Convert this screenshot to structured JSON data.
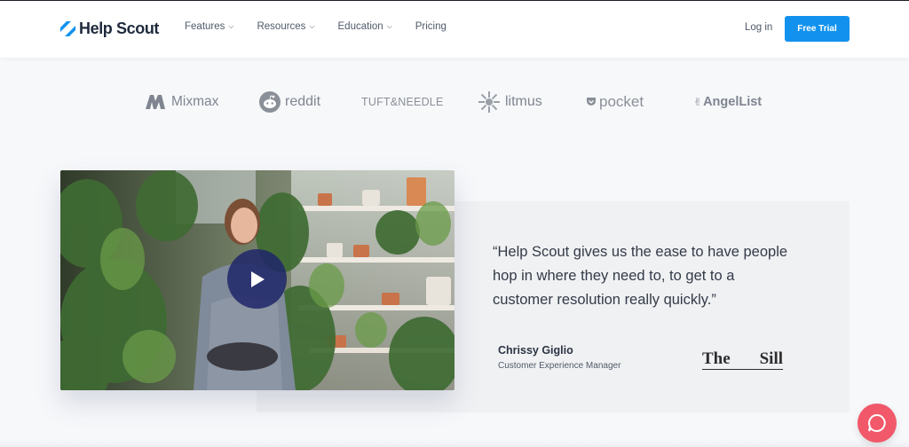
{
  "header": {
    "brand": "Help Scout",
    "nav": [
      {
        "label": "Features",
        "dropdown": true
      },
      {
        "label": "Resources",
        "dropdown": true
      },
      {
        "label": "Education",
        "dropdown": true
      },
      {
        "label": "Pricing",
        "dropdown": false
      }
    ],
    "login_label": "Log in",
    "cta_label": "Free Trial"
  },
  "customer_logos": [
    {
      "name": "Mixmax",
      "icon": "mixmax-m-icon"
    },
    {
      "name": "reddit",
      "icon": "reddit-alien-icon"
    },
    {
      "name": "TUFT&NEEDLE",
      "icon": null
    },
    {
      "name": "litmus",
      "icon": "litmus-burst-icon"
    },
    {
      "name": "pocket",
      "icon": "pocket-icon"
    },
    {
      "name": "AngelList",
      "icon": "peace-hand-icon"
    }
  ],
  "testimonial": {
    "quote": "“Help Scout gives us the ease to have people hop in where they need to, to get to a customer resolution really quickly.”",
    "author_name": "Chrissy Giglio",
    "author_role": "Customer Experience Manager",
    "company_word1": "The",
    "company_word2": "Sill",
    "video_icon": "play-icon"
  },
  "chat_widget_icon": "chat-bubble-icon",
  "colors": {
    "accent": "#1292ee",
    "brand": "#1f2a3c",
    "logo_blue": "#1292ee",
    "chat": "#f1586a",
    "play_button": "#1e2669"
  }
}
